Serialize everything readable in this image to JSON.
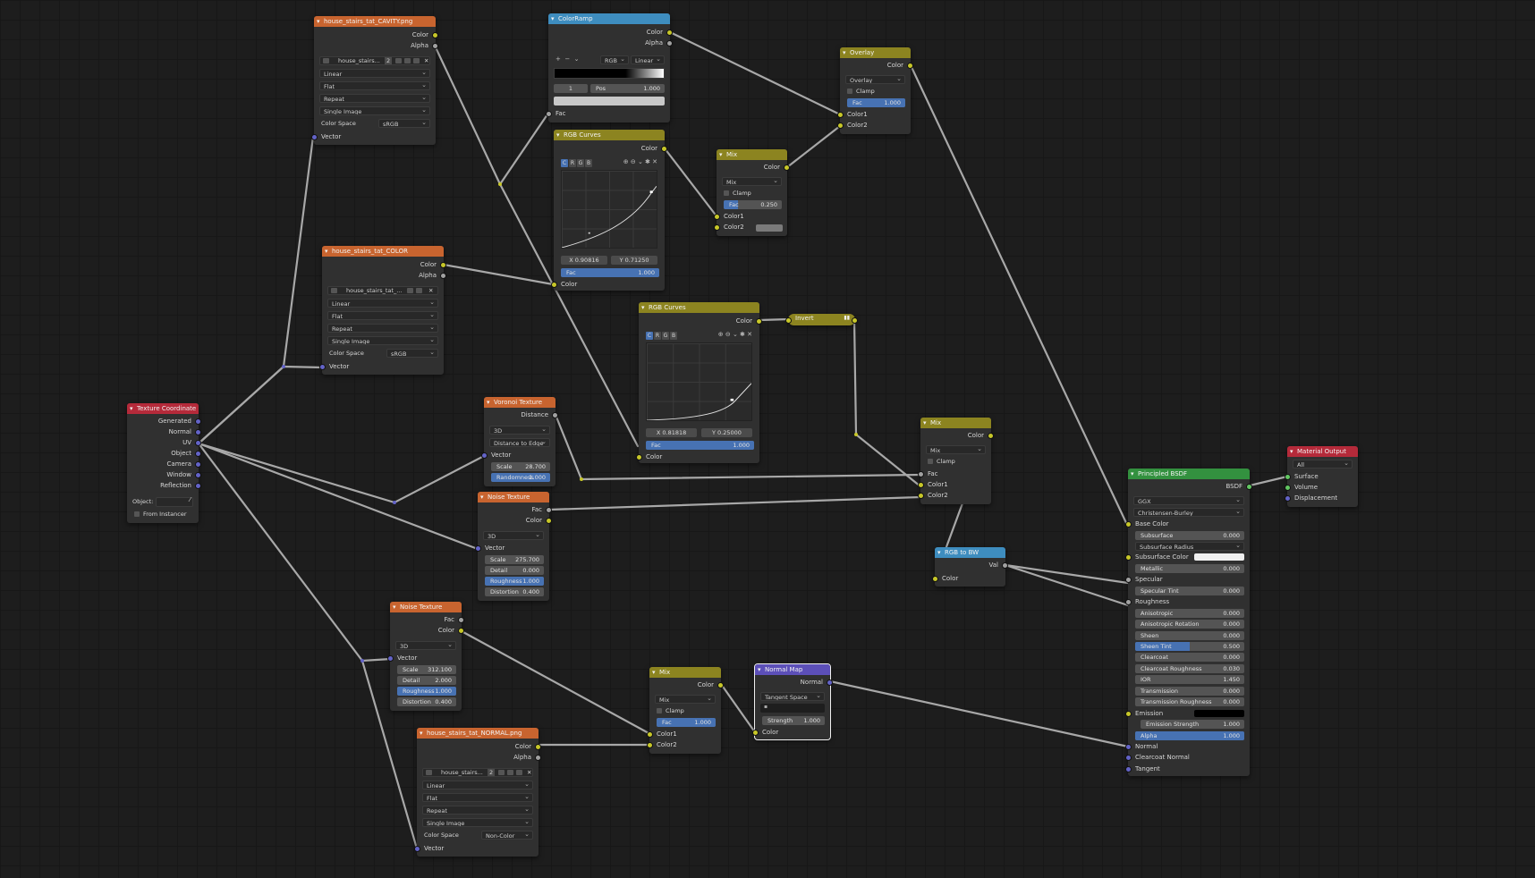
{
  "nodes": {
    "cavity": {
      "title": "house_stairs_tat_CAVITY.png",
      "out_color": "Color",
      "out_alpha": "Alpha",
      "image_name": "house_stairs...",
      "users": "2",
      "interpolation": "Linear",
      "projection": "Flat",
      "extension": "Repeat",
      "source": "Single Image",
      "colorspace_label": "Color Space",
      "colorspace": "sRGB",
      "in_vector": "Vector"
    },
    "color_tex": {
      "title": "house_stairs_tat_COLOR",
      "out_color": "Color",
      "out_alpha": "Alpha",
      "image_name": "house_stairs_tat_...",
      "interpolation": "Linear",
      "projection": "Flat",
      "extension": "Repeat",
      "source": "Single Image",
      "colorspace_label": "Color Space",
      "colorspace": "sRGB",
      "in_vector": "Vector"
    },
    "texcoord": {
      "title": "Texture Coordinate",
      "outputs": [
        "Generated",
        "Normal",
        "UV",
        "Object",
        "Camera",
        "Window",
        "Reflection"
      ],
      "object_label": "Object:",
      "from_instancer": "From Instancer"
    },
    "colorramp": {
      "title": "ColorRamp",
      "out_color": "Color",
      "out_alpha": "Alpha",
      "mode": "RGB",
      "interp": "Linear",
      "stop_index": "1",
      "pos_label": "Pos",
      "pos_value": "1.000",
      "in_fac": "Fac"
    },
    "curves1": {
      "title": "RGB Curves",
      "out_color": "Color",
      "tabs": [
        "C",
        "R",
        "G",
        "B"
      ],
      "x": "X 0.90816",
      "y": "Y 0.71250",
      "fac_label": "Fac",
      "fac_value": "1.000",
      "in_color": "Color"
    },
    "mix_small": {
      "title": "Mix",
      "out_color": "Color",
      "blend": "Mix",
      "clamp": "Clamp",
      "fac_label": "Fac",
      "fac_value": "0.250",
      "in_color1": "Color1",
      "in_color2": "Color2"
    },
    "overlay": {
      "title": "Overlay",
      "out_color": "Color",
      "blend": "Overlay",
      "clamp": "Clamp",
      "fac_label": "Fac",
      "fac_value": "1.000",
      "in_color1": "Color1",
      "in_color2": "Color2"
    },
    "curves2": {
      "title": "RGB Curves",
      "out_color": "Color",
      "tabs": [
        "C",
        "R",
        "G",
        "B"
      ],
      "x": "X 0.81818",
      "y": "Y 0.25000",
      "fac_label": "Fac",
      "fac_value": "1.000",
      "in_color": "Color"
    },
    "invert": {
      "title": "Invert"
    },
    "voronoi": {
      "title": "Voronoi Texture",
      "out_distance": "Distance",
      "dimensions": "3D",
      "feature": "Distance to Edge",
      "in_vector": "Vector",
      "scale_label": "Scale",
      "scale_value": "28.700",
      "rand_label": "Randomness",
      "rand_value": "1.000"
    },
    "noise1": {
      "title": "Noise Texture",
      "out_fac": "Fac",
      "out_color": "Color",
      "dimensions": "3D",
      "in_vector": "Vector",
      "scale_label": "Scale",
      "scale_value": "275.700",
      "detail_label": "Detail",
      "detail_value": "0.000",
      "rough_label": "Roughness",
      "rough_value": "1.000",
      "dist_label": "Distortion",
      "dist_value": "0.400"
    },
    "mix_mid": {
      "title": "Mix",
      "out_color": "Color",
      "blend": "Mix",
      "clamp": "Clamp",
      "in_fac": "Fac",
      "in_color1": "Color1",
      "in_color2": "Color2"
    },
    "rgb2bw": {
      "title": "RGB to BW",
      "out_val": "Val",
      "in_color": "Color"
    },
    "noise2": {
      "title": "Noise Texture",
      "out_fac": "Fac",
      "out_color": "Color",
      "dimensions": "3D",
      "in_vector": "Vector",
      "scale_label": "Scale",
      "scale_value": "312.100",
      "detail_label": "Detail",
      "detail_value": "2.000",
      "rough_label": "Roughness",
      "rough_value": "1.000",
      "dist_label": "Distortion",
      "dist_value": "0.400"
    },
    "normal_tex": {
      "title": "house_stairs_tat_NORMAL.png",
      "out_color": "Color",
      "out_alpha": "Alpha",
      "image_name": "house_stairs...",
      "users": "2",
      "interpolation": "Linear",
      "projection": "Flat",
      "extension": "Repeat",
      "source": "Single Image",
      "colorspace_label": "Color Space",
      "colorspace": "Non-Color",
      "in_vector": "Vector"
    },
    "mix_bottom": {
      "title": "Mix",
      "out_color": "Color",
      "blend": "Mix",
      "clamp": "Clamp",
      "fac_label": "Fac",
      "fac_value": "1.000",
      "in_color1": "Color1",
      "in_color2": "Color2"
    },
    "normalmap": {
      "title": "Normal Map",
      "out_normal": "Normal",
      "space": "Tangent Space",
      "strength_label": "Strength",
      "strength_value": "1.000",
      "in_color": "Color"
    },
    "bsdf": {
      "title": "Principled BSDF",
      "out_bsdf": "BSDF",
      "distribution": "GGX",
      "sss_method": "Christensen-Burley",
      "rows": [
        {
          "label": "Base Color",
          "type": "socket"
        },
        {
          "label": "Subsurface",
          "value": "0.000"
        },
        {
          "label": "Subsurface Radius",
          "type": "dropdown"
        },
        {
          "label": "Subsurface Color",
          "type": "color"
        },
        {
          "label": "Metallic",
          "value": "0.000"
        },
        {
          "label": "Specular",
          "type": "socket"
        },
        {
          "label": "Specular Tint",
          "value": "0.000"
        },
        {
          "label": "Roughness",
          "type": "socket"
        },
        {
          "label": "Anisotropic",
          "value": "0.000"
        },
        {
          "label": "Anisotropic Rotation",
          "value": "0.000"
        },
        {
          "label": "Sheen",
          "value": "0.000"
        },
        {
          "label": "Sheen Tint",
          "value": "0.500",
          "fill": 0.5
        },
        {
          "label": "Clearcoat",
          "value": "0.000"
        },
        {
          "label": "Clearcoat Roughness",
          "value": "0.030"
        },
        {
          "label": "IOR",
          "value": "1.450"
        },
        {
          "label": "Transmission",
          "value": "0.000"
        },
        {
          "label": "Transmission Roughness",
          "value": "0.000"
        },
        {
          "label": "Emission",
          "type": "black"
        },
        {
          "label": "Emission Strength",
          "value": "1.000"
        },
        {
          "label": "Alpha",
          "value": "1.000",
          "fill": 1.0
        },
        {
          "label": "Normal",
          "type": "socket"
        },
        {
          "label": "Clearcoat Normal",
          "type": "socket"
        },
        {
          "label": "Tangent",
          "type": "socket"
        }
      ]
    },
    "output": {
      "title": "Material Output",
      "target": "All",
      "in_surface": "Surface",
      "in_volume": "Volume",
      "in_displacement": "Displacement"
    }
  },
  "colors": {
    "texture_header": "#c8642f",
    "color_header": "#8c8420",
    "converter_header": "#3e8dbf",
    "vector_header": "#5c4fb8",
    "input_header": "#b52a3a",
    "shader_header": "#33913f",
    "accent_field": "#4772b3",
    "wire": "#a8a8a8"
  }
}
